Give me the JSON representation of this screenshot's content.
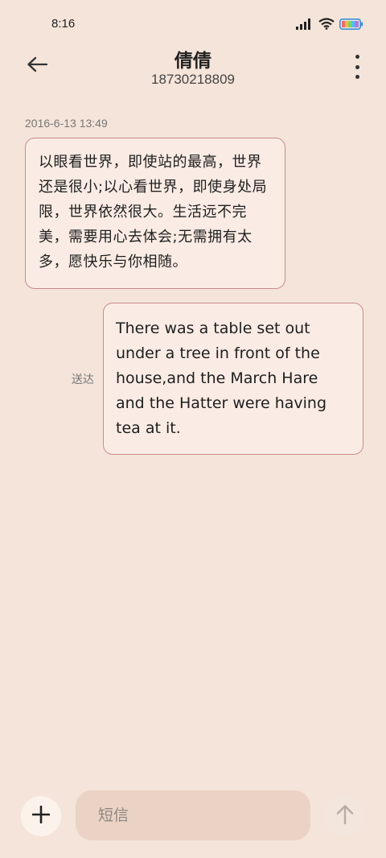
{
  "status_bar": {
    "time": "8:16",
    "icons": [
      "signal-icon",
      "wifi-icon",
      "battery-icon"
    ]
  },
  "header": {
    "contact_name": "倩倩",
    "phone_number": "18730218809",
    "back_icon": "arrow-left-icon",
    "more_icon": "more-vertical-icon"
  },
  "conversation": {
    "timestamp": "2016-6-13 13:49",
    "messages": [
      {
        "direction": "incoming",
        "text": "以眼看世界，即使站的最高，世界还是很小;以心看世界，即使身处局限，世界依然很大。生活远不完美，需要用心去体会;无需拥有太多，愿快乐与你相随。"
      },
      {
        "direction": "outgoing",
        "text": "There was a table set out under a tree in front of the house,and the March Hare and the Hatter were having tea at it.",
        "status": "送达"
      }
    ]
  },
  "composer": {
    "placeholder": "短信",
    "add_icon": "plus-icon",
    "send_icon": "arrow-up-icon"
  },
  "colors": {
    "background": "#f5e4d9",
    "bubble_fill": "#faece4",
    "bubble_border": "#c98a8e",
    "input_fill": "#ead3c4"
  }
}
